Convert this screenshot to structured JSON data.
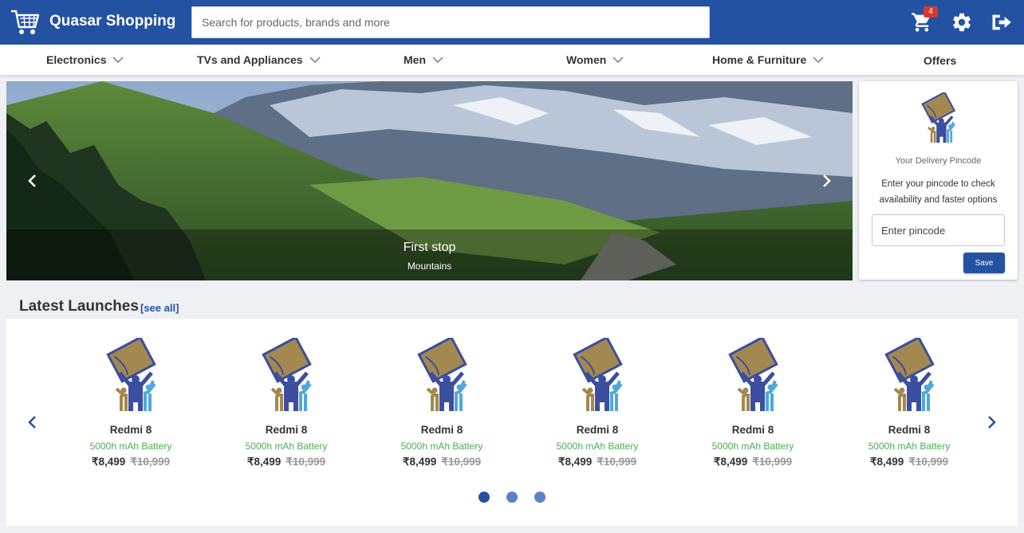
{
  "header": {
    "brand": "Quasar Shopping",
    "search_placeholder": "Search for products, brands and more",
    "cart_count": "4",
    "icons": [
      "cart-icon",
      "settings-icon",
      "logout-icon"
    ]
  },
  "nav": {
    "items": [
      {
        "label": "Electronics",
        "has_dropdown": true
      },
      {
        "label": "TVs and Appliances",
        "has_dropdown": true
      },
      {
        "label": "Men",
        "has_dropdown": true
      },
      {
        "label": "Women",
        "has_dropdown": true
      },
      {
        "label": "Home & Furniture",
        "has_dropdown": true
      },
      {
        "label": "Offers",
        "has_dropdown": false
      }
    ]
  },
  "banner": {
    "title": "First stop",
    "subtitle": "Mountains"
  },
  "pincode": {
    "title": "Your Delivery Pincode",
    "description": "Enter your pincode to check availability and faster options",
    "placeholder": "Enter pincode",
    "save_label": "Save"
  },
  "launches": {
    "title": "Latest Launches",
    "see_all": "[see all]",
    "products": [
      {
        "name": "Redmi 8",
        "feature": "5000h mAh Battery",
        "price": "₹8,499",
        "old_price": "₹10,999"
      },
      {
        "name": "Redmi 8",
        "feature": "5000h mAh Battery",
        "price": "₹8,499",
        "old_price": "₹10,999"
      },
      {
        "name": "Redmi 8",
        "feature": "5000h mAh Battery",
        "price": "₹8,499",
        "old_price": "₹10,999"
      },
      {
        "name": "Redmi 8",
        "feature": "5000h mAh Battery",
        "price": "₹8,499",
        "old_price": "₹10,999"
      },
      {
        "name": "Redmi 8",
        "feature": "5000h mAh Battery",
        "price": "₹8,499",
        "old_price": "₹10,999"
      },
      {
        "name": "Redmi 8",
        "feature": "5000h mAh Battery",
        "price": "₹8,499",
        "old_price": "₹10,999"
      }
    ],
    "active_page": 1,
    "page_count": 3
  },
  "colors": {
    "primary": "#2452a3",
    "badge": "#d9392b",
    "feature_green": "#4caf50",
    "dot_inactive": "#5b82c4"
  }
}
